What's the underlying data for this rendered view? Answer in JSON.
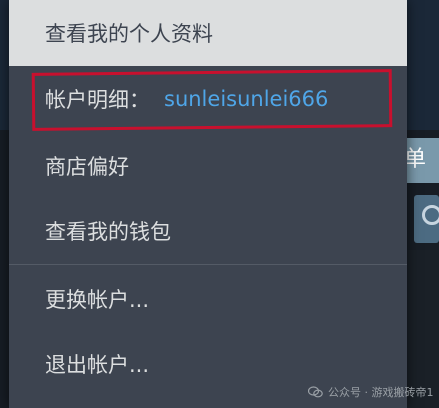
{
  "menu": {
    "view_profile": "查看我的个人资料",
    "account_details_label": "帐户明细：",
    "account_username": "sunleisunlei666",
    "store_preferences": "商店偏好",
    "view_wallet": "查看我的钱包",
    "change_account": "更换帐户...",
    "sign_out": "退出帐户..."
  },
  "background": {
    "partial_text": "单"
  },
  "watermark": {
    "text": "公众号 · 游戏搬砖帝1"
  },
  "colors": {
    "menu_bg": "#3d4450",
    "hover_bg": "#dcdedf",
    "text": "#dcdedf",
    "username": "#4fa6e8",
    "highlight_border": "#c8102e"
  },
  "icons": {
    "search": "search-icon",
    "watermark": "wechat-icon"
  }
}
